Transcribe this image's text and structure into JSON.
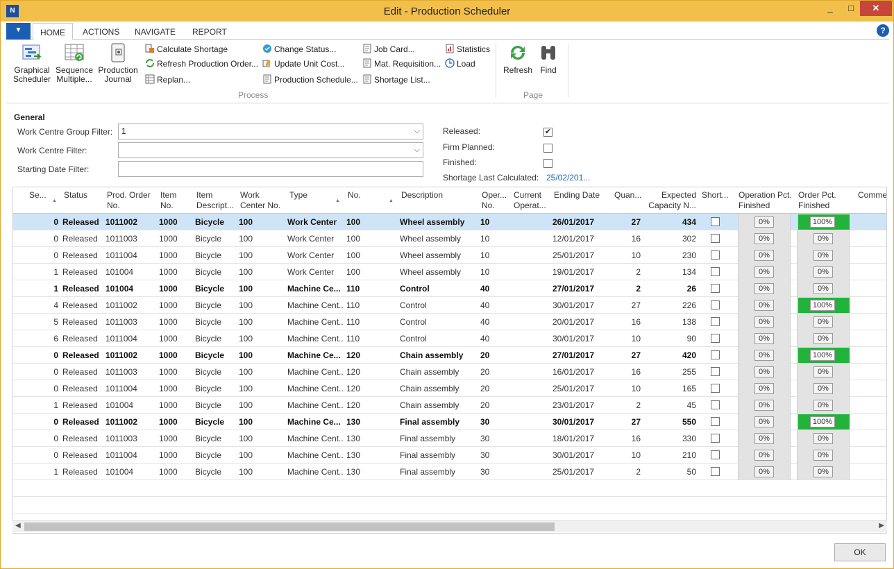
{
  "window": {
    "title": "Edit - Production Scheduler",
    "min": "_",
    "max": "□",
    "close": "✕"
  },
  "tabs": [
    {
      "label": "HOME"
    },
    {
      "label": "ACTIONS"
    },
    {
      "label": "NAVIGATE"
    },
    {
      "label": "REPORT"
    }
  ],
  "ribbon": {
    "graphical_scheduler": "Graphical Scheduler",
    "sequence_multiple": "Sequence Multiple...",
    "production_journal": "Production Journal",
    "calculate_shortage": "Calculate Shortage",
    "refresh_production_order": "Refresh Production Order...",
    "replan": "Replan...",
    "change_status": "Change Status...",
    "update_unit_cost": "Update Unit Cost...",
    "production_schedule": "Production Schedule...",
    "job_card": "Job Card...",
    "mat_requisition": "Mat. Requisition...",
    "shortage_list": "Shortage List...",
    "statistics": "Statistics",
    "load": "Load",
    "group_process": "Process",
    "refresh": "Refresh",
    "find": "Find",
    "group_page": "Page"
  },
  "general": {
    "title": "General",
    "wc_group_filter_label": "Work Centre Group Filter:",
    "wc_group_filter_value": "1",
    "wc_filter_label": "Work Centre Filter:",
    "wc_filter_value": "",
    "start_date_label": "Starting Date Filter:",
    "start_date_value": "",
    "released_label": "Released:",
    "released_checked": "✔",
    "firm_planned_label": "Firm Planned:",
    "finished_label": "Finished:",
    "shortage_label": "Shortage Last Calculated:",
    "shortage_value": "25/02/201..."
  },
  "columns": {
    "seq": "Se...",
    "status": "Status",
    "prod_order": "Prod. Order No.",
    "item_no": "Item No.",
    "item_desc": "Item Descript...",
    "work_center_no": "Work Center No.",
    "type": "Type",
    "no": "No.",
    "description": "Description",
    "oper_no": "Oper... No.",
    "current_oper": "Current Operat...",
    "ending_date": "Ending Date",
    "quantity": "Quan...",
    "expected_capacity": "Expected Capacity N...",
    "shortage": "Short...",
    "op_pct": "Operation Pct. Finished",
    "order_pct": "Order Pct. Finished",
    "comment": "Comme..."
  },
  "rows": [
    {
      "seq": "0",
      "status": "Released",
      "prod": "1011002",
      "item": "1000",
      "desc": "Bicycle",
      "wc": "100",
      "type": "Work Center",
      "no": "100",
      "description": "Wheel assembly",
      "oper": "10",
      "end": "26/01/2017",
      "qty": "27",
      "cap": "434",
      "op_pct": "0%",
      "order_pct": "100%",
      "bold": true,
      "selected": true
    },
    {
      "seq": "0",
      "status": "Released",
      "prod": "1011003",
      "item": "1000",
      "desc": "Bicycle",
      "wc": "100",
      "type": "Work Center",
      "no": "100",
      "description": "Wheel assembly",
      "oper": "10",
      "end": "12/01/2017",
      "qty": "16",
      "cap": "302",
      "op_pct": "0%",
      "order_pct": "0%"
    },
    {
      "seq": "0",
      "status": "Released",
      "prod": "1011004",
      "item": "1000",
      "desc": "Bicycle",
      "wc": "100",
      "type": "Work Center",
      "no": "100",
      "description": "Wheel assembly",
      "oper": "10",
      "end": "25/01/2017",
      "qty": "10",
      "cap": "230",
      "op_pct": "0%",
      "order_pct": "0%"
    },
    {
      "seq": "1",
      "status": "Released",
      "prod": "101004",
      "item": "1000",
      "desc": "Bicycle",
      "wc": "100",
      "type": "Work Center",
      "no": "100",
      "description": "Wheel assembly",
      "oper": "10",
      "end": "19/01/2017",
      "qty": "2",
      "cap": "134",
      "op_pct": "0%",
      "order_pct": "0%"
    },
    {
      "seq": "1",
      "status": "Released",
      "prod": "101004",
      "item": "1000",
      "desc": "Bicycle",
      "wc": "100",
      "type": "Machine Ce...",
      "no": "110",
      "description": "Control",
      "oper": "40",
      "end": "27/01/2017",
      "qty": "2",
      "cap": "26",
      "op_pct": "0%",
      "order_pct": "0%",
      "bold": true
    },
    {
      "seq": "4",
      "status": "Released",
      "prod": "1011002",
      "item": "1000",
      "desc": "Bicycle",
      "wc": "100",
      "type": "Machine Cent...",
      "no": "110",
      "description": "Control",
      "oper": "40",
      "end": "30/01/2017",
      "qty": "27",
      "cap": "226",
      "op_pct": "0%",
      "order_pct": "100%"
    },
    {
      "seq": "5",
      "status": "Released",
      "prod": "1011003",
      "item": "1000",
      "desc": "Bicycle",
      "wc": "100",
      "type": "Machine Cent...",
      "no": "110",
      "description": "Control",
      "oper": "40",
      "end": "20/01/2017",
      "qty": "16",
      "cap": "138",
      "op_pct": "0%",
      "order_pct": "0%"
    },
    {
      "seq": "6",
      "status": "Released",
      "prod": "1011004",
      "item": "1000",
      "desc": "Bicycle",
      "wc": "100",
      "type": "Machine Cent...",
      "no": "110",
      "description": "Control",
      "oper": "40",
      "end": "30/01/2017",
      "qty": "10",
      "cap": "90",
      "op_pct": "0%",
      "order_pct": "0%"
    },
    {
      "seq": "0",
      "status": "Released",
      "prod": "1011002",
      "item": "1000",
      "desc": "Bicycle",
      "wc": "100",
      "type": "Machine Ce...",
      "no": "120",
      "description": "Chain assembly",
      "oper": "20",
      "end": "27/01/2017",
      "qty": "27",
      "cap": "420",
      "op_pct": "0%",
      "order_pct": "100%",
      "bold": true
    },
    {
      "seq": "0",
      "status": "Released",
      "prod": "1011003",
      "item": "1000",
      "desc": "Bicycle",
      "wc": "100",
      "type": "Machine Cent...",
      "no": "120",
      "description": "Chain assembly",
      "oper": "20",
      "end": "16/01/2017",
      "qty": "16",
      "cap": "255",
      "op_pct": "0%",
      "order_pct": "0%"
    },
    {
      "seq": "0",
      "status": "Released",
      "prod": "1011004",
      "item": "1000",
      "desc": "Bicycle",
      "wc": "100",
      "type": "Machine Cent...",
      "no": "120",
      "description": "Chain assembly",
      "oper": "20",
      "end": "25/01/2017",
      "qty": "10",
      "cap": "165",
      "op_pct": "0%",
      "order_pct": "0%"
    },
    {
      "seq": "1",
      "status": "Released",
      "prod": "101004",
      "item": "1000",
      "desc": "Bicycle",
      "wc": "100",
      "type": "Machine Cent...",
      "no": "120",
      "description": "Chain assembly",
      "oper": "20",
      "end": "23/01/2017",
      "qty": "2",
      "cap": "45",
      "op_pct": "0%",
      "order_pct": "0%"
    },
    {
      "seq": "0",
      "status": "Released",
      "prod": "1011002",
      "item": "1000",
      "desc": "Bicycle",
      "wc": "100",
      "type": "Machine Ce...",
      "no": "130",
      "description": "Final assembly",
      "oper": "30",
      "end": "30/01/2017",
      "qty": "27",
      "cap": "550",
      "op_pct": "0%",
      "order_pct": "100%",
      "bold": true
    },
    {
      "seq": "0",
      "status": "Released",
      "prod": "1011003",
      "item": "1000",
      "desc": "Bicycle",
      "wc": "100",
      "type": "Machine Cent...",
      "no": "130",
      "description": "Final assembly",
      "oper": "30",
      "end": "18/01/2017",
      "qty": "16",
      "cap": "330",
      "op_pct": "0%",
      "order_pct": "0%"
    },
    {
      "seq": "0",
      "status": "Released",
      "prod": "1011004",
      "item": "1000",
      "desc": "Bicycle",
      "wc": "100",
      "type": "Machine Cent...",
      "no": "130",
      "description": "Final assembly",
      "oper": "30",
      "end": "30/01/2017",
      "qty": "10",
      "cap": "210",
      "op_pct": "0%",
      "order_pct": "0%"
    },
    {
      "seq": "1",
      "status": "Released",
      "prod": "101004",
      "item": "1000",
      "desc": "Bicycle",
      "wc": "100",
      "type": "Machine Cent...",
      "no": "130",
      "description": "Final assembly",
      "oper": "30",
      "end": "25/01/2017",
      "qty": "2",
      "cap": "50",
      "op_pct": "0%",
      "order_pct": "0%"
    }
  ],
  "colors": {
    "accent": "#1a5fb4",
    "title_bar": "#f2c04a",
    "selected_row": "#cfe5f7",
    "complete": "#21b33a"
  },
  "ok_label": "OK"
}
